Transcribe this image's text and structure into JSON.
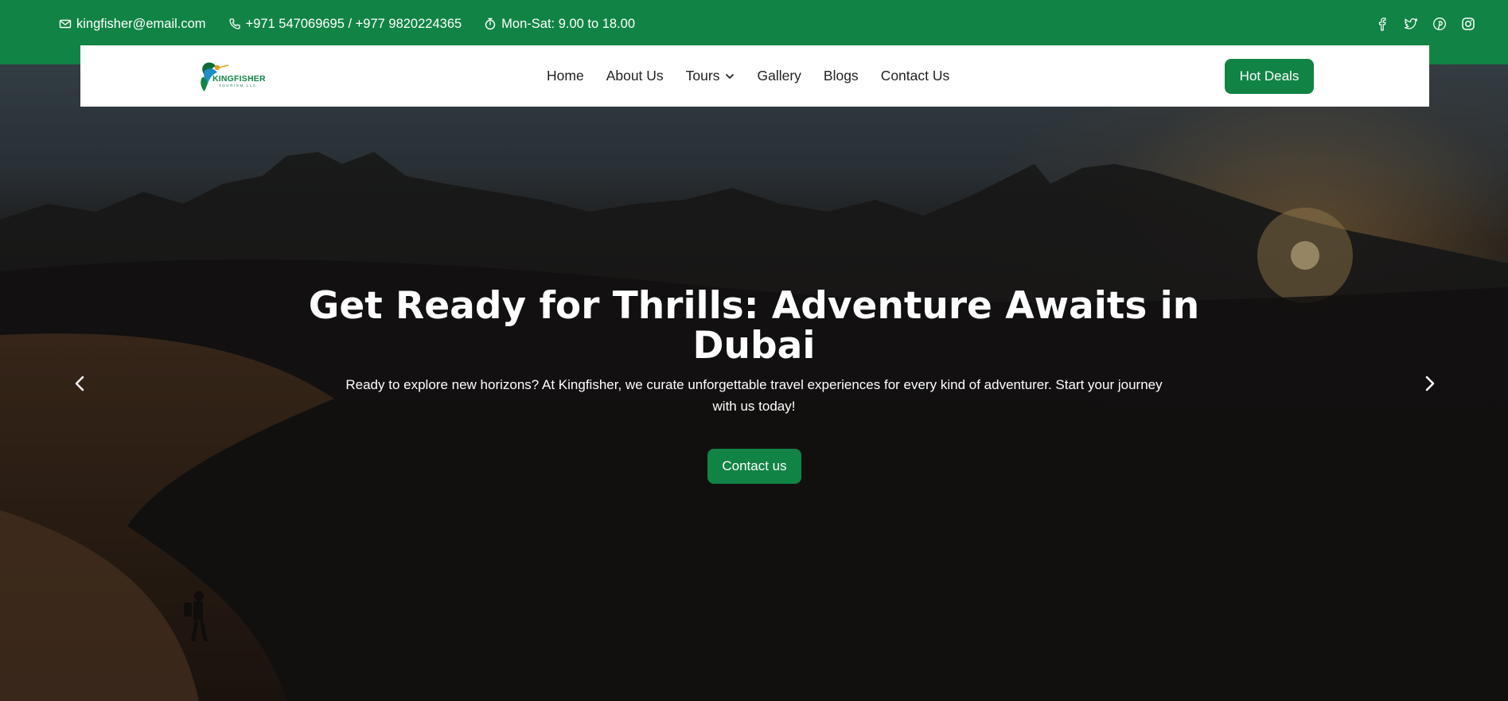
{
  "topbar": {
    "email": "kingfisher@email.com",
    "phone": "+971 547069695 / +977 9820224365",
    "hours": "Mon-Sat: 9.00 to 18.00",
    "social_icons": [
      "facebook-icon",
      "twitter-icon",
      "pinterest-icon",
      "instagram-icon"
    ]
  },
  "logo": {
    "name": "KINGFISHER",
    "tagline": "TOURISM LLC"
  },
  "nav": {
    "items": [
      {
        "label": "Home"
      },
      {
        "label": "About Us"
      },
      {
        "label": "Tours"
      },
      {
        "label": "Gallery"
      },
      {
        "label": "Blogs"
      },
      {
        "label": "Contact Us"
      }
    ],
    "cta_label": "Hot Deals"
  },
  "hero": {
    "title": "Get Ready for Thrills: Adventure Awaits in Dubai",
    "subtitle": "Ready to explore new horizons? At Kingfisher, we curate unforgettable travel experiences for every kind of adventurer. Start your journey with us today!",
    "cta_label": "Contact us"
  },
  "colors": {
    "brand_green": "#118445",
    "white": "#ffffff",
    "dark_text": "#222222"
  }
}
